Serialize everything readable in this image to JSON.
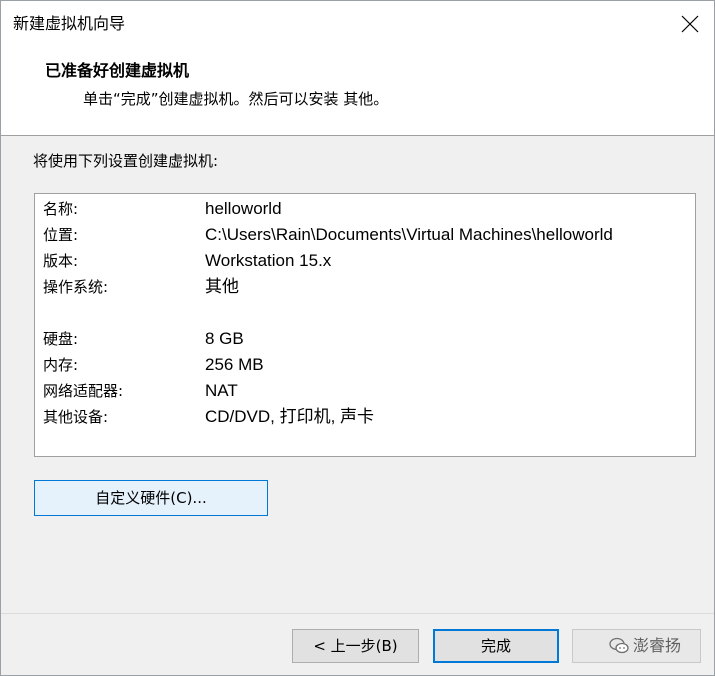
{
  "window": {
    "title": "新建虚拟机向导"
  },
  "header": {
    "title": "已准备好创建虚拟机",
    "subtitle": "单击“完成”创建虚拟机。然后可以安装 其他。"
  },
  "intro": "将使用下列设置创建虚拟机:",
  "summary": [
    {
      "key": "名称:",
      "value": "helloworld"
    },
    {
      "key": "位置:",
      "value": "C:\\Users\\Rain\\Documents\\Virtual Machines\\helloworld"
    },
    {
      "key": "版本:",
      "value": "Workstation 15.x"
    },
    {
      "key": "操作系统:",
      "value": "其他"
    },
    {
      "key": "硬盘:",
      "value": "8 GB"
    },
    {
      "key": "内存:",
      "value": "256 MB"
    },
    {
      "key": "网络适配器:",
      "value": "NAT"
    },
    {
      "key": "其他设备:",
      "value": "CD/DVD, 打印机, 声卡"
    }
  ],
  "buttons": {
    "customize": "自定义硬件(C)...",
    "back": "< 上一步(B)",
    "finish": "完成"
  },
  "watermark": {
    "text": "澎睿扬"
  },
  "colors": {
    "accent": "#0078d7",
    "window_bg": "#f0f0f0",
    "button_bg": "#e1e1e1"
  }
}
